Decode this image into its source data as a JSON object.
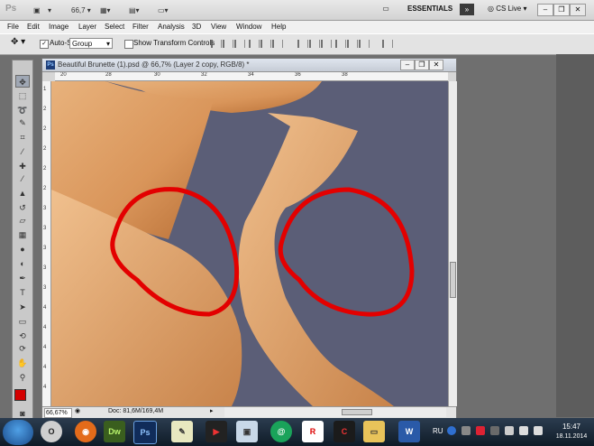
{
  "app": {
    "logo": "Ps",
    "zoom_display": "66,7",
    "workspace": "ESSENTIALS",
    "cs_live": "CS Live"
  },
  "menu": [
    "File",
    "Edit",
    "Image",
    "Layer",
    "Select",
    "Filter",
    "Analysis",
    "3D",
    "View",
    "Window",
    "Help"
  ],
  "options": {
    "auto_select_label": "Auto-Select:",
    "auto_select_value": "Group",
    "show_transform_label": "Show Transform Controls"
  },
  "document": {
    "title": "Beautiful Brunette (1).psd @ 66,7% (Layer 2 copy, RGB/8) *",
    "ruler_h": [
      "20",
      "28",
      "30",
      "32",
      "34",
      "36",
      "38"
    ],
    "ruler_v": [
      "1",
      "2",
      "2",
      "2",
      "2",
      "2",
      "3",
      "3",
      "3",
      "3",
      "3",
      "4",
      "4",
      "4",
      "4",
      "4"
    ],
    "zoom": "66,67%",
    "doc_size": "Doc: 81,6M/169,4M"
  },
  "colors": {
    "foreground": "#d40000",
    "background": "#ffffff",
    "canvas_bg": "#5b5e77",
    "annotation": "#e30000"
  },
  "toolbox": {
    "tools": [
      "move-icon",
      "marquee-icon",
      "lasso-icon",
      "quick-select-icon",
      "crop-icon",
      "eyedropper-icon",
      "healing-icon",
      "brush-icon",
      "clone-stamp-icon",
      "history-brush-icon",
      "eraser-icon",
      "gradient-icon",
      "blur-icon",
      "dodge-icon",
      "pen-icon",
      "type-icon",
      "path-select-icon",
      "shape-icon",
      "3d-rotate-icon",
      "3d-orbit-icon",
      "hand-icon",
      "zoom-icon"
    ]
  },
  "taskbar": {
    "apps": [
      "opera",
      "firefox",
      "dreamweaver",
      "photoshop",
      "notepad",
      "media-player",
      "image-viewer",
      "instagram",
      "r-app",
      "ccleaner",
      "folder",
      "word"
    ],
    "app_labels": {
      "dreamweaver": "Dw",
      "photoshop": "Ps",
      "word": "W",
      "r-app": "R"
    },
    "language": "RU",
    "time": "15:47",
    "date": "18.11.2014"
  }
}
